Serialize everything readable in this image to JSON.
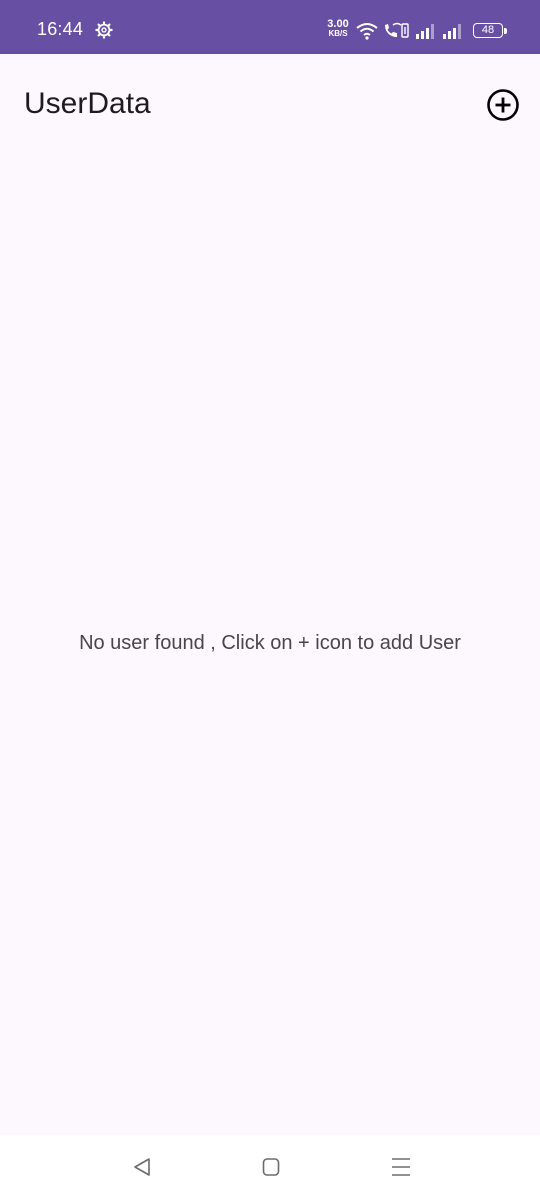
{
  "status_bar": {
    "time": "16:44",
    "net_speed_value": "3.00",
    "net_speed_unit": "KB/S",
    "battery_level": "48",
    "background_color": "#6750a4"
  },
  "app_bar": {
    "title": "UserData",
    "add_icon": "add-circle-icon"
  },
  "main": {
    "empty_message": "No user found , Click on + icon to add User"
  },
  "nav_bar": {
    "back_icon": "back-triangle-icon",
    "home_icon": "home-square-icon",
    "recents_icon": "menu-lines-icon"
  },
  "colors": {
    "status_bar": "#6750a4",
    "background": "#fdf8fd",
    "title_text": "#1d1b20",
    "body_text": "#49454f"
  }
}
